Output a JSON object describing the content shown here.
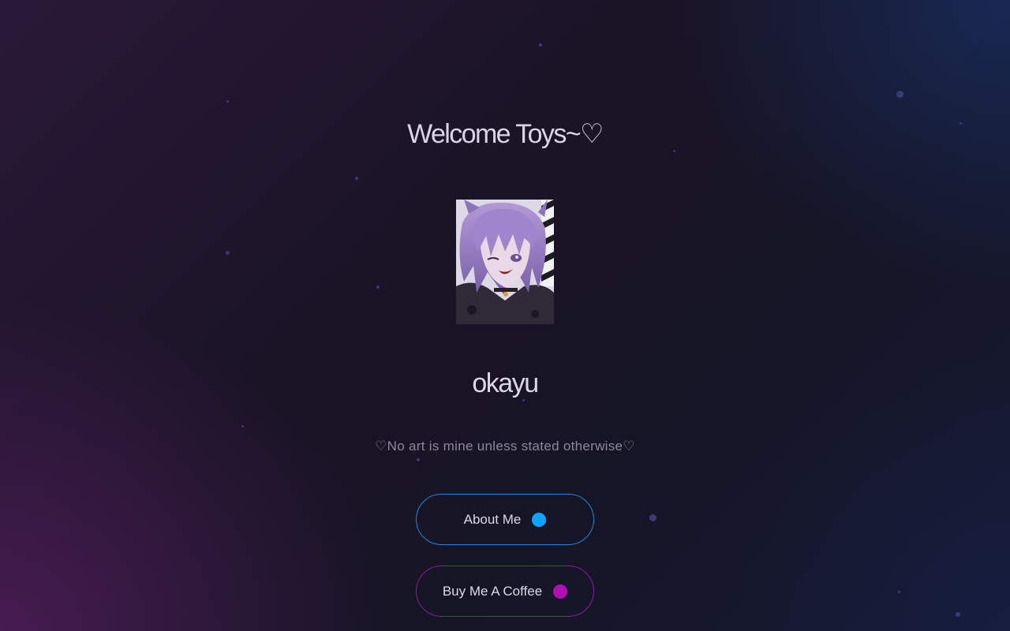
{
  "header": {
    "welcome_text": "Welcome Toys~♡"
  },
  "profile": {
    "avatar_description": "purple-haired anime character winking",
    "username": "okayu",
    "tagline": "♡No art is mine unless stated otherwise♡"
  },
  "links": [
    {
      "label": "About Me",
      "indicator_color": "#0ea5ff"
    },
    {
      "label": "Buy Me A Coffee",
      "indicator_color": "#b00fb6"
    }
  ],
  "colors": {
    "about_border": "#1f86d6",
    "coffee_border": "#8a1b9e",
    "particle": "#3c3a78"
  }
}
